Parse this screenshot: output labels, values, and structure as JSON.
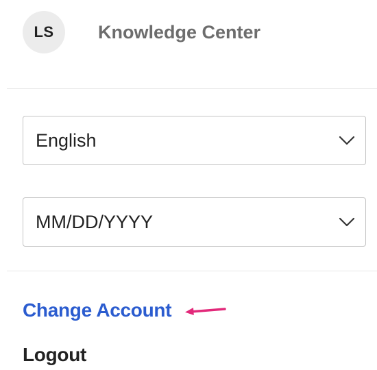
{
  "header": {
    "avatar_initials": "LS",
    "title": "Knowledge Center"
  },
  "language_select": {
    "value": "English",
    "icon": "chevron-down-icon"
  },
  "date_format_select": {
    "value": "MM/DD/YYYY",
    "icon": "chevron-down-icon"
  },
  "links": {
    "change_account": "Change Account",
    "logout": "Logout"
  },
  "annotation": {
    "icon": "arrow-left-icon",
    "color": "#e2297a"
  },
  "colors": {
    "link": "#2b5ccf",
    "header_title": "#6d6d6d",
    "avatar_bg": "#ececec"
  }
}
